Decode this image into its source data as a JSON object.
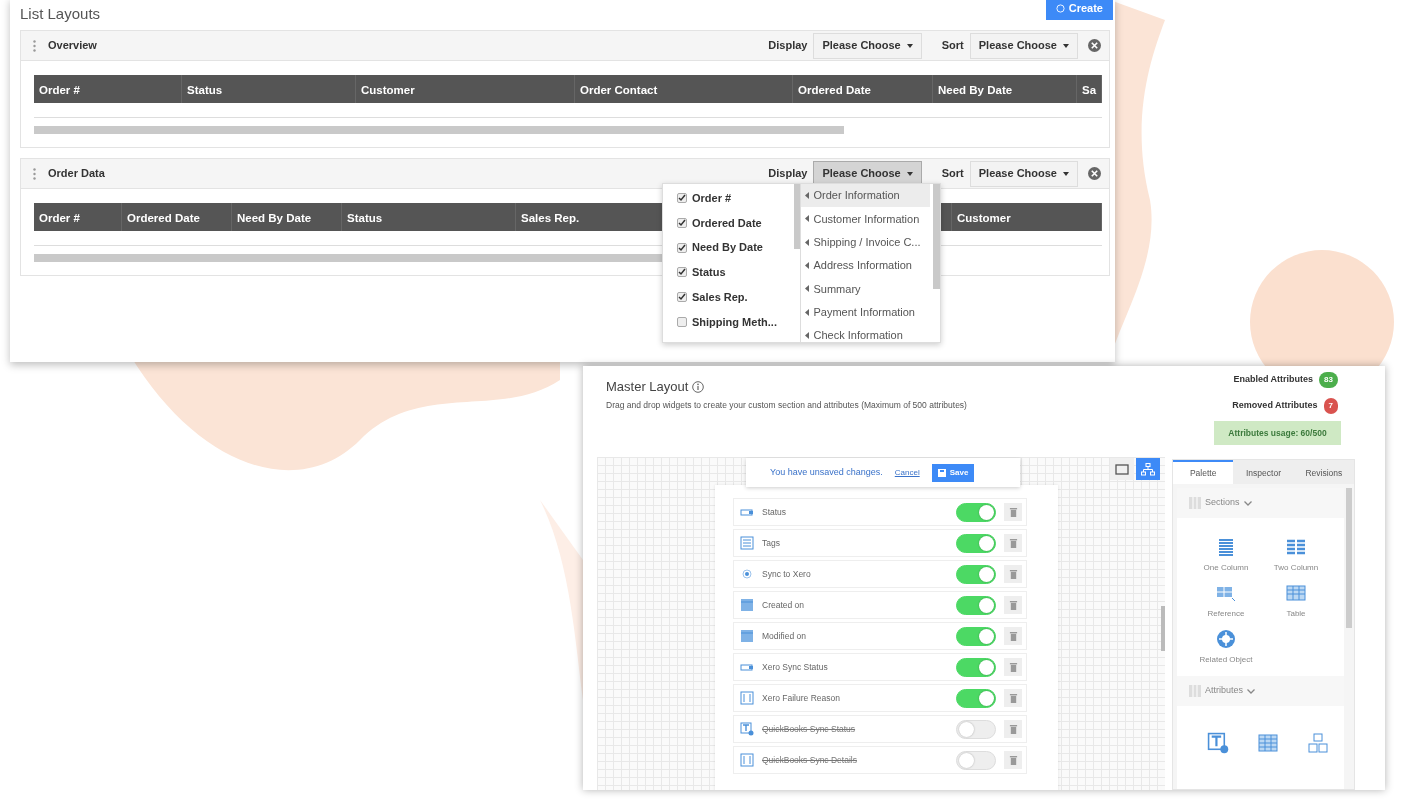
{
  "list_layouts": {
    "title": "List Layouts",
    "create_button": "Create",
    "sections": [
      {
        "name": "Overview",
        "display_label": "Display",
        "display_value": "Please Choose",
        "display_open": false,
        "sort_label": "Sort",
        "sort_value": "Please Choose",
        "columns": [
          "Order #",
          "Status",
          "Customer",
          "Order Contact",
          "Ordered Date",
          "Need By Date",
          "Sa"
        ]
      },
      {
        "name": "Order Data",
        "display_label": "Display",
        "display_value": "Please Choose",
        "display_open": true,
        "sort_label": "Sort",
        "sort_value": "Please Choose",
        "columns": [
          "Order #",
          "Ordered Date",
          "Need By Date",
          "Status",
          "Sales Rep.",
          "Customer"
        ]
      }
    ],
    "display_menu": {
      "columns": [
        {
          "label": "Order #",
          "checked": true
        },
        {
          "label": "Ordered Date",
          "checked": true
        },
        {
          "label": "Need By Date",
          "checked": true
        },
        {
          "label": "Status",
          "checked": true
        },
        {
          "label": "Sales Rep.",
          "checked": true
        },
        {
          "label": "Shipping Meth...",
          "checked": false
        }
      ],
      "groups": [
        {
          "label": "Order Information",
          "selected": true
        },
        {
          "label": "Customer Information",
          "selected": false
        },
        {
          "label": "Shipping / Invoice C...",
          "selected": false
        },
        {
          "label": "Address Information",
          "selected": false
        },
        {
          "label": "Summary",
          "selected": false
        },
        {
          "label": "Payment Information",
          "selected": false
        },
        {
          "label": "Check Information",
          "selected": false
        }
      ]
    }
  },
  "master_layout": {
    "title": "Master Layout",
    "description": "Drag and drop widgets to create your custom section and attributes (Maximum of 500 attributes)",
    "enabled": {
      "label": "Enabled Attributes",
      "count": "83"
    },
    "removed": {
      "label": "Removed Attributes",
      "count": "7"
    },
    "usage": "Attributes usage: 60/500",
    "unsaved": {
      "message": "You have unsaved changes.",
      "cancel": "Cancel",
      "save": "Save"
    },
    "view_buttons": [
      {
        "kind": "tablet",
        "selected": false
      },
      {
        "kind": "hierarchy",
        "selected": true
      }
    ],
    "fields": [
      {
        "label": "Status",
        "kind": "input",
        "on": true
      },
      {
        "label": "Tags",
        "kind": "list",
        "on": true
      },
      {
        "label": "Sync to Xero",
        "kind": "radio",
        "on": true
      },
      {
        "label": "Created on",
        "kind": "date",
        "on": true
      },
      {
        "label": "Modified on",
        "kind": "date",
        "on": true
      },
      {
        "label": "Xero Sync Status",
        "kind": "input",
        "on": true
      },
      {
        "label": "Xero Failure Reason",
        "kind": "textarea",
        "on": true
      },
      {
        "label": "QuickBooks Sync Status",
        "kind": "text-add",
        "on": false
      },
      {
        "label": "QuickBooks Sync Details",
        "kind": "textarea",
        "on": false
      }
    ],
    "palette": {
      "tabs": [
        {
          "label": "Palette",
          "selected": true
        },
        {
          "label": "Inspector",
          "selected": false
        },
        {
          "label": "Revisions",
          "selected": false
        }
      ],
      "groups": [
        {
          "title": "Sections",
          "items": [
            {
              "label": "One Column",
              "kind": "one-column"
            },
            {
              "label": "Two Column",
              "kind": "two-column"
            },
            {
              "label": "Reference",
              "kind": "reference"
            },
            {
              "label": "Table",
              "kind": "table"
            },
            {
              "label": "Related Object",
              "kind": "related"
            }
          ]
        },
        {
          "title": "Attributes",
          "items": [
            {
              "kind": "text-add"
            },
            {
              "kind": "grid"
            },
            {
              "kind": "blocks"
            }
          ]
        }
      ]
    }
  }
}
